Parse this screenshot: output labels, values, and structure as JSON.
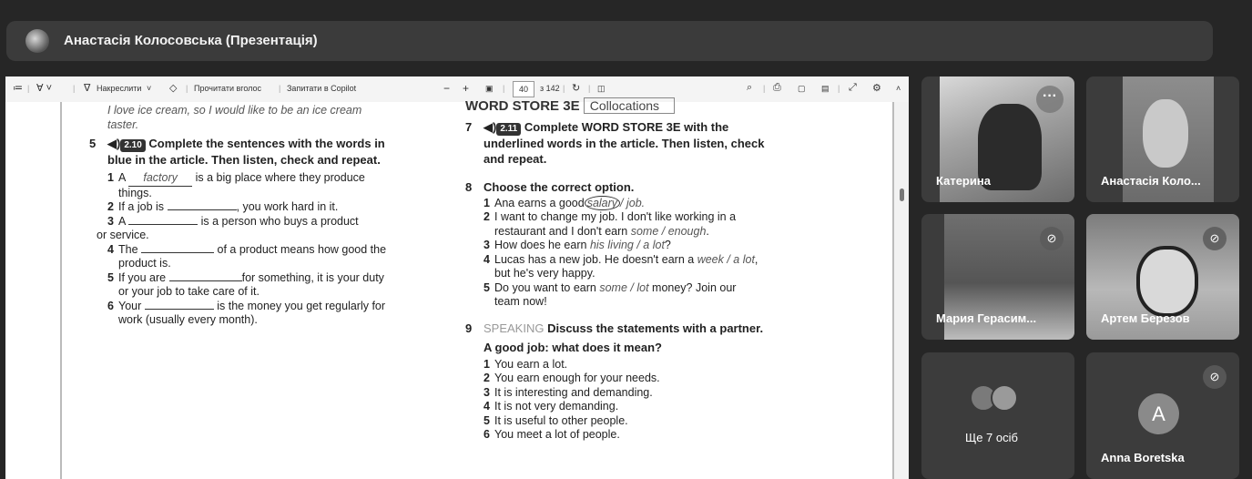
{
  "header": {
    "title": "Анастасія Колосовська (Презентація)"
  },
  "toolbar": {
    "contents_icon": "≔",
    "draw_label": "Накреслити",
    "read_aloud": "Прочитати вголос",
    "ask_copilot": "Запитати в Copilot",
    "zoom_out": "−",
    "zoom_in": "+",
    "page_current": "40",
    "page_total": "з 142"
  },
  "document": {
    "left": {
      "intro_line1": "I love ice cream, so I would like to be an ice cream",
      "intro_line2": "taster.",
      "ex5_num": "5",
      "ex5_badge": "2.10",
      "ex5_title1": "Complete the sentences with the words in",
      "ex5_title2": "blue in the article. Then listen, check and repeat.",
      "items": [
        {
          "n": "1",
          "a": "A",
          "blank": "factory",
          "b": "is a big place where they produce",
          "c": "things."
        },
        {
          "n": "2",
          "a": "If a job is",
          "b": ", you work hard in it."
        },
        {
          "n": "3",
          "a": "A",
          "b": "is a person who buys a product",
          "c": "or service."
        },
        {
          "n": "4",
          "a": "The",
          "b": "of a product means how good the",
          "c": "product is."
        },
        {
          "n": "5",
          "a": "If you are",
          "b": "for something, it is your duty",
          "c": "or your job to take care of it."
        },
        {
          "n": "6",
          "a": "Your",
          "b": "is the money you get regularly for",
          "c": "work (usually every month)."
        }
      ]
    },
    "right": {
      "wordstore": "WORD STORE 3E",
      "wordstore_sub": "Collocations",
      "ex7_num": "7",
      "ex7_badge": "2.11",
      "ex7_text1": "Complete WORD STORE 3E with the",
      "ex7_text2": "underlined words in the article. Then listen, check",
      "ex7_text3": "and repeat.",
      "ex8_num": "8",
      "ex8_title": "Choose the correct option.",
      "ex8_items": [
        {
          "n": "1",
          "a": "Ana earns a good",
          "b": "salary",
          "c": "/ job."
        },
        {
          "n": "2",
          "a": "I want to change my job. I don't like working in a",
          "b": "restaurant and I don't earn",
          "c": "some / enough",
          "d": "."
        },
        {
          "n": "3",
          "a": "How does he earn",
          "b": "his living / a lot",
          "c": "?"
        },
        {
          "n": "4",
          "a": "Lucas has a new job. He doesn't earn a",
          "b": "week / a lot",
          "c": ",",
          "d": "but he's very happy."
        },
        {
          "n": "5",
          "a": "Do you want to earn",
          "b": "some / lot",
          "c": "money? Join our",
          "d": "team now!"
        }
      ],
      "ex9_num": "9",
      "ex9_speaking": "SPEAKING",
      "ex9_title": "Discuss the statements with a partner.",
      "ex9_sub": "A good job: what does it mean?",
      "ex9_items": [
        {
          "n": "1",
          "t": "You earn a lot."
        },
        {
          "n": "2",
          "t": "You earn enough for your needs."
        },
        {
          "n": "3",
          "t": "It is interesting and demanding."
        },
        {
          "n": "4",
          "t": "It is not very demanding."
        },
        {
          "n": "5",
          "t": "It is useful to other people."
        },
        {
          "n": "6",
          "t": "You meet a lot of people."
        }
      ]
    }
  },
  "participants": [
    {
      "name": "Катерина",
      "muted": false
    },
    {
      "name": "Анастасія Коло...",
      "muted": false
    },
    {
      "name": "Мария Герасим...",
      "muted": true
    },
    {
      "name": "Артем Березов",
      "muted": true
    },
    {
      "name": "Ще 7 осіб",
      "muted": false
    },
    {
      "name": "Anna Boretska",
      "muted": true,
      "initial": "A"
    }
  ],
  "icons": {
    "mic_off": "mic-off-icon",
    "more": "more-options-icon"
  },
  "colors": {
    "background": "#262626",
    "tile": "#3c3c3c",
    "header": "#3b3b3b"
  }
}
